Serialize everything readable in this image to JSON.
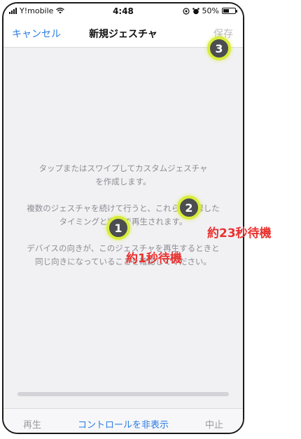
{
  "status_bar": {
    "carrier": "Y!mobile",
    "time": "4:48",
    "battery_percent": "50%",
    "battery_level": 0.5,
    "icons": [
      "signal-icon",
      "wifi-icon",
      "location-icon",
      "alarm-icon",
      "battery-icon"
    ]
  },
  "nav": {
    "cancel_label": "キャンセル",
    "title": "新規ジェスチャ",
    "save_label": "保存"
  },
  "instructions": {
    "line1": "タップまたはスワイプしてカスタムジェスチャ",
    "line2": "を作成します。",
    "line3": "複数のジェスチャを続けて行うと、これらを記録した",
    "line4": "タイミングと順序で再生されます。",
    "line5": "デバイスの向きが、このジェスチャを再生するときと",
    "line6": "同じ向きになっていることを確認してください。"
  },
  "toolbar": {
    "play_label": "再生",
    "hide_controls_label": "コントロールを非表示",
    "stop_label": "中止"
  },
  "annotations": {
    "marker1": "1",
    "marker2": "2",
    "marker3": "3",
    "note_wait1": "約1秒待機",
    "note_wait23": "約23秒待機"
  },
  "colors": {
    "accent_blue": "#2a7be4",
    "annotation_red": "#e8322f",
    "marker_ring": "#d8ec3a"
  }
}
